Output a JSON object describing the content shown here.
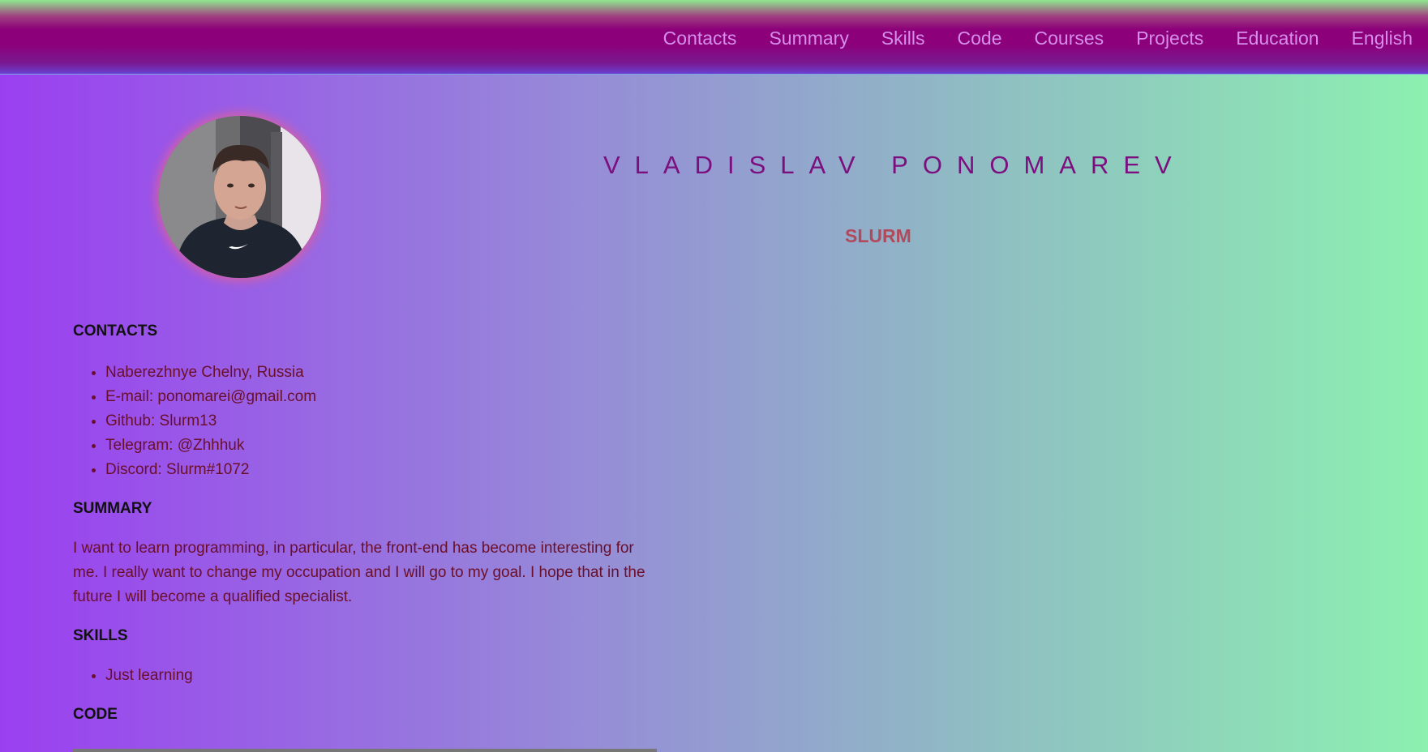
{
  "nav": {
    "items": [
      {
        "label": "Contacts"
      },
      {
        "label": "Summary"
      },
      {
        "label": "Skills"
      },
      {
        "label": "Code"
      },
      {
        "label": "Courses"
      },
      {
        "label": "Projects"
      },
      {
        "label": "Education"
      },
      {
        "label": "English"
      }
    ]
  },
  "header": {
    "name": "VLADISLAV PONOMAREV",
    "subtitle": "SLURM"
  },
  "contacts": {
    "title": "CONTACTS",
    "items": [
      "Naberezhnye Chelny, Russia",
      "E-mail: ponomarei@gmail.com",
      "Github: Slurm13",
      "Telegram: @Zhhhuk",
      "Discord: Slurm#1072"
    ]
  },
  "summary": {
    "title": "SUMMARY",
    "text": "I want to learn programming, in particular, the front-end has become interesting for me. I really want to change my occupation and I will go to my goal. I hope that in the future I will become a qualified specialist."
  },
  "skills": {
    "title": "SKILLS",
    "items": [
      "Just learning"
    ]
  },
  "code": {
    "title": "CODE"
  },
  "colors": {
    "nav_link": "#d58ee9",
    "name": "#7c0f80",
    "subtitle": "#b04a5c"
  }
}
